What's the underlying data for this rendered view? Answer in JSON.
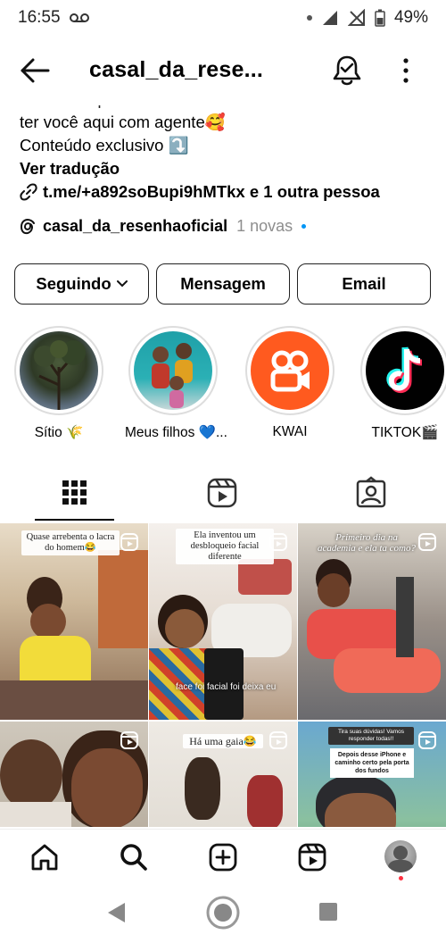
{
  "status": {
    "time": "16:55",
    "battery": "49%"
  },
  "header": {
    "title": "casal_da_rese..."
  },
  "bio": {
    "line1": "ter você aqui com agente🥰",
    "line2": "Conteúdo exclusivo ⤵️",
    "translate": "Ver tradução",
    "link": "t.me/+a892soBupi9hMTkx e 1 outra pessoa"
  },
  "threads": {
    "handle": "casal_da_resenhaoficial",
    "new": "1 novas"
  },
  "buttons": {
    "following": "Seguindo",
    "message": "Mensagem",
    "email": "Email"
  },
  "highlights": [
    {
      "label": "Sítio 🌾"
    },
    {
      "label": "Meus filhos 💙..."
    },
    {
      "label": "KWAI"
    },
    {
      "label": "TIKTOK🎬"
    }
  ],
  "posts": [
    {
      "caption": "Quase arrebenta o lacra do homem😂"
    },
    {
      "caption": "Ela inventou um desbloqueio facial diferente",
      "overlay": "face foi facial foi deixa eu"
    },
    {
      "caption": "Primeiro dia na academia e ela ta como?"
    },
    {
      "caption": ""
    },
    {
      "caption": "Há uma gaia😂"
    },
    {
      "caption": "Tira suas dúvidas! Vamos responder todas!!",
      "overlay": "Depois desse iPhone e caminho certo pela porta dos fundos"
    }
  ],
  "colors": {
    "link_blue": "#0095f6",
    "kwai": "#ff5a1f",
    "tiktok": "#010101"
  }
}
